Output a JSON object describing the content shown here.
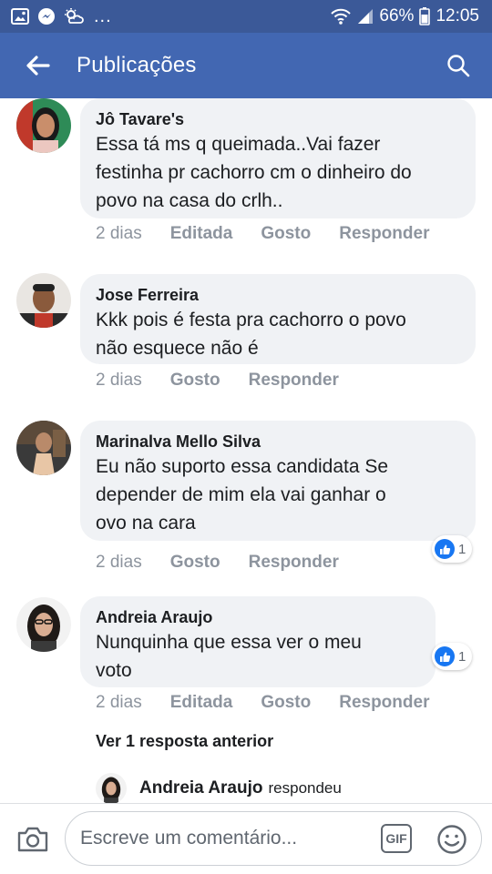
{
  "status_bar": {
    "battery": "66%",
    "time": "12:05",
    "more": "...",
    "icons": [
      "gallery-icon",
      "messenger-icon",
      "weather-icon",
      "wifi-icon",
      "signal-icon",
      "battery-icon"
    ]
  },
  "header": {
    "title": "Publicações",
    "back_icon": "arrow-left-icon",
    "search_icon": "search-icon",
    "background": "#4267b2"
  },
  "comments": [
    {
      "author": "Jô Tavare's",
      "text": [
        "Essa tá ms q queimada..Vai fazer",
        "festinha pr cachorro cm o dinheiro do",
        "povo na casa do crlh.."
      ],
      "time": "2 dias",
      "edited": "Editada",
      "like": "Gosto",
      "reply": "Responder"
    },
    {
      "author": "Jose Ferreira",
      "text": [
        "Kkk pois é festa pra cachorro o povo",
        "não esquece não é"
      ],
      "time": "2 dias",
      "like": "Gosto",
      "reply": "Responder"
    },
    {
      "author": "Marinalva Mello Silva",
      "text": [
        "Eu não suporto essa candidata Se",
        "depender de mim ela vai ganhar o",
        "ovo na cara"
      ],
      "time": "2 dias",
      "like": "Gosto",
      "reply": "Responder",
      "reactions": "1"
    },
    {
      "author": "Andreia Araujo",
      "text": [
        "Nunquinha  que essa ver o  meu",
        "voto"
      ],
      "time": "2 dias",
      "edited": "Editada",
      "like": "Gosto",
      "reply": "Responder",
      "reactions": "1"
    }
  ],
  "replies": {
    "view_previous": "Ver 1 resposta anterior",
    "preview_author": "Andreia Araujo",
    "preview_action": "respondeu"
  },
  "composer": {
    "placeholder": "Escreve um comentário...",
    "gif_label": "GIF",
    "camera_icon": "camera-icon",
    "emoji_icon": "emoji-icon"
  },
  "colors": {
    "brand": "#4267b2",
    "status_bar": "#3b5998",
    "bubble": "#f0f2f5",
    "meta_text": "#8d949e",
    "like_blue": "#1877f2"
  }
}
